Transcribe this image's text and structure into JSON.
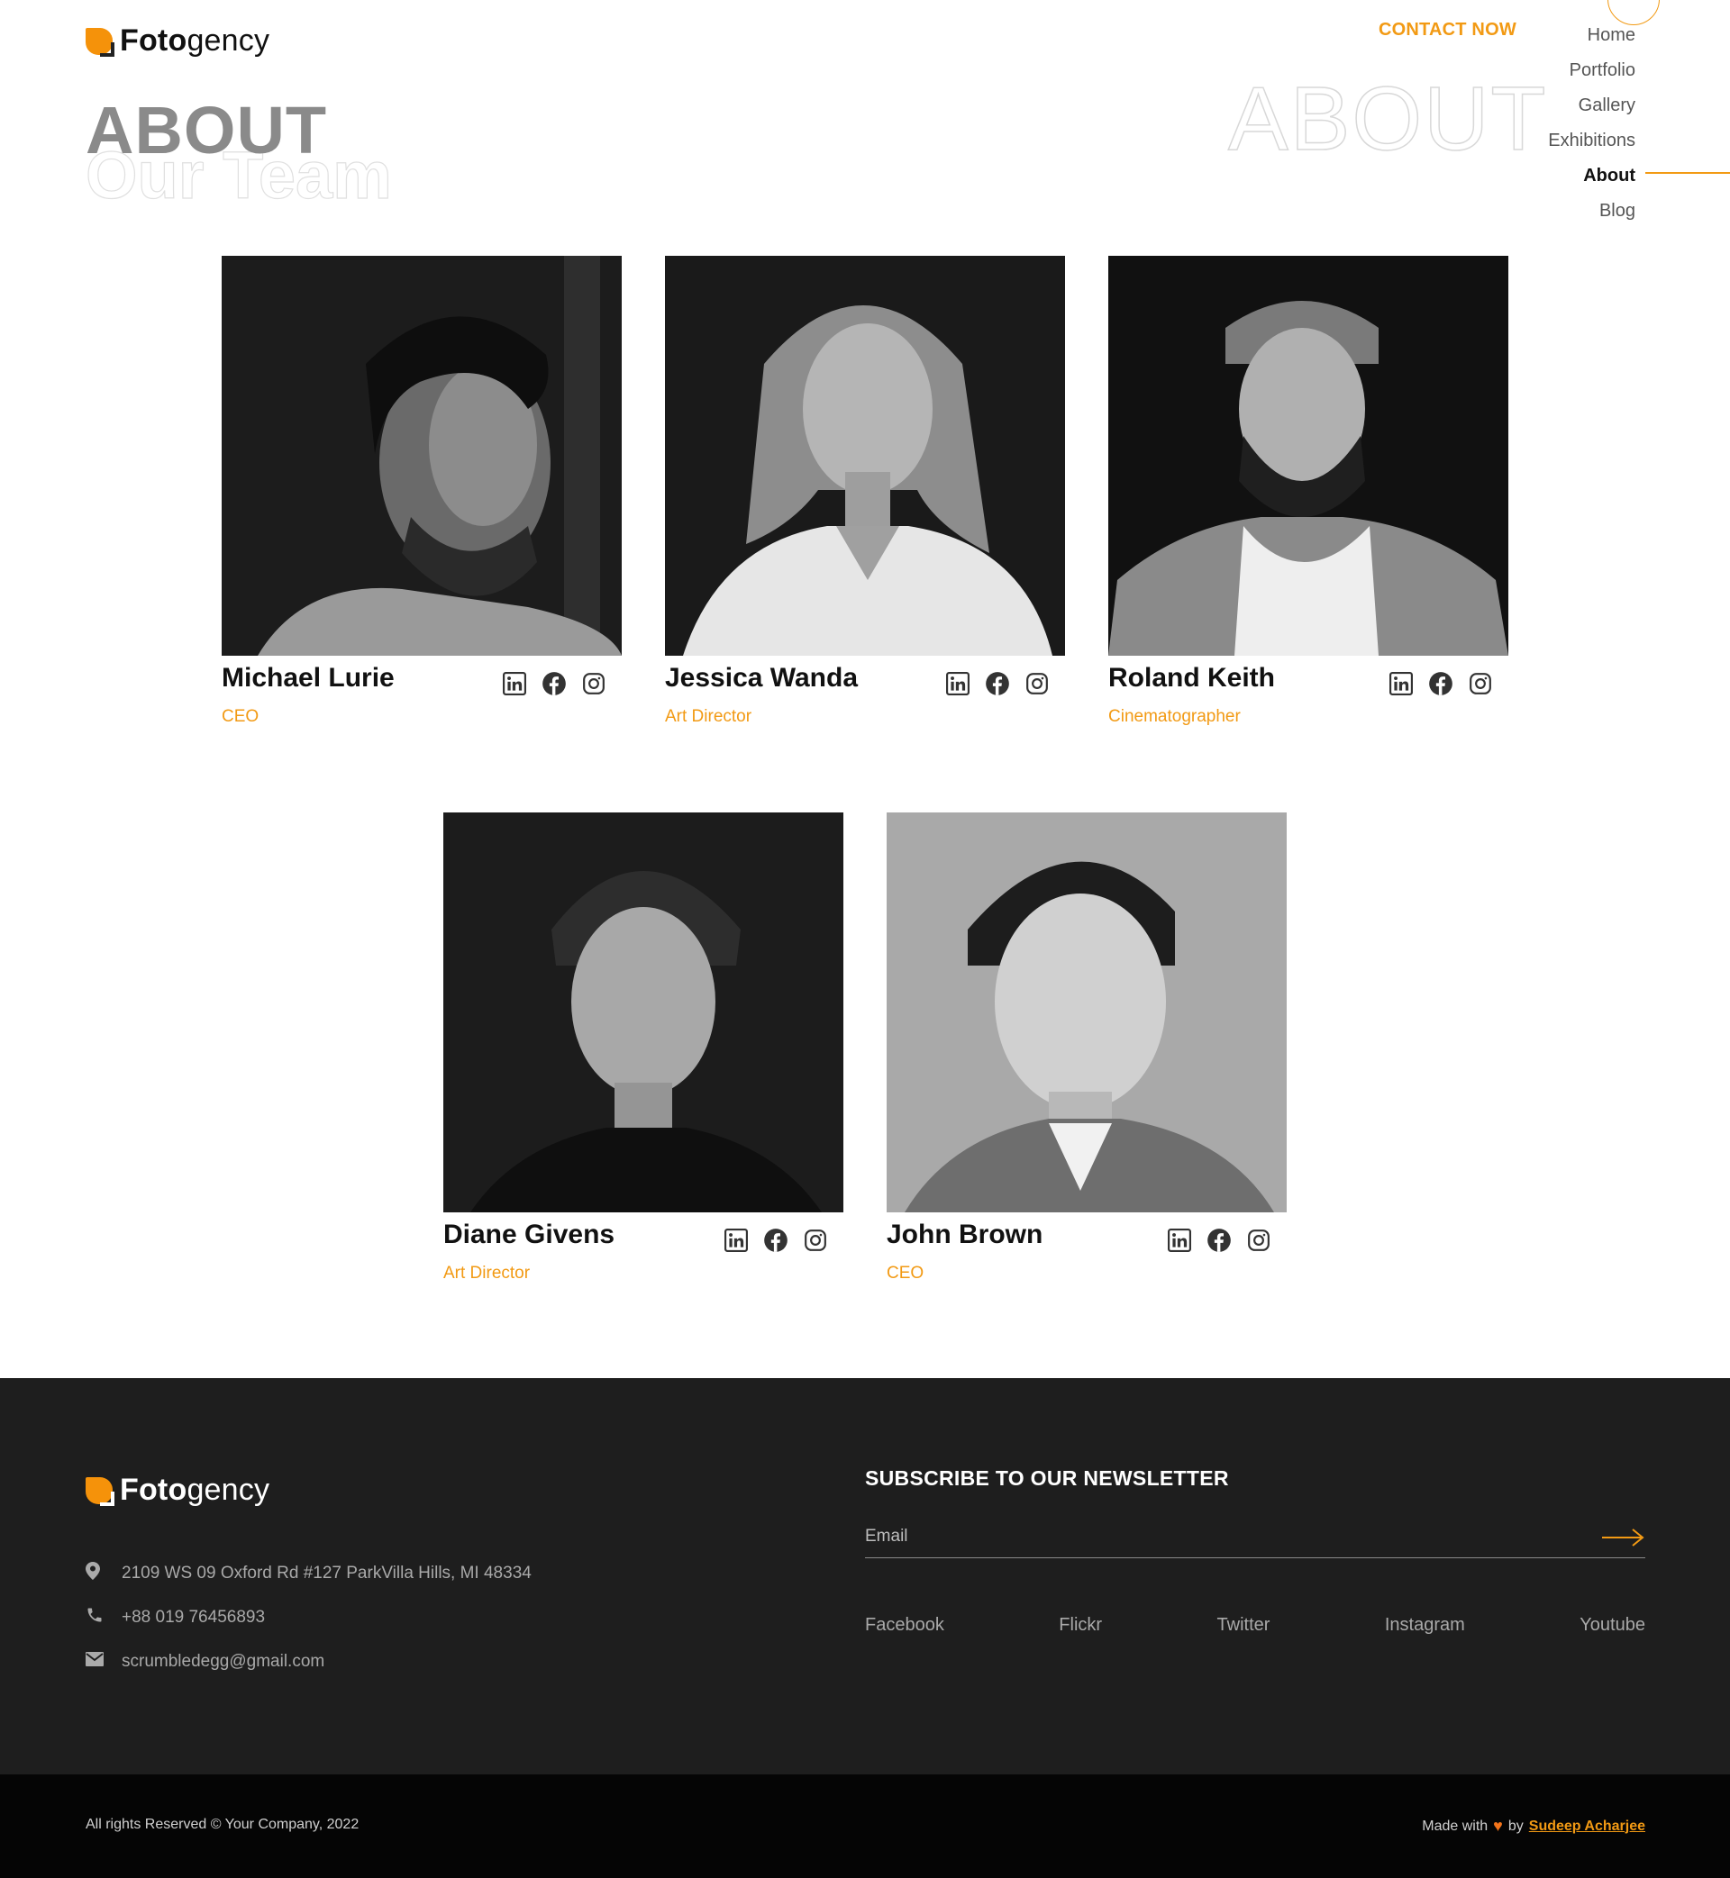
{
  "brand": {
    "bold": "Foto",
    "light": "gency"
  },
  "header": {
    "contact_label": "CONTACT NOW",
    "nav": [
      "Home",
      "Portfolio",
      "Gallery",
      "Exhibitions",
      "About",
      "Blog"
    ],
    "active_nav": "About"
  },
  "hero": {
    "title": "ABOUT",
    "subtitle_outline": "Our Team",
    "background_word": "ABOUT"
  },
  "team": [
    {
      "name": "Michael Lurie",
      "role": "CEO"
    },
    {
      "name": "Jessica Wanda",
      "role": "Art Director"
    },
    {
      "name": "Roland Keith",
      "role": "Cinematographer"
    },
    {
      "name": "Diane Givens",
      "role": "Art Director"
    },
    {
      "name": "John Brown",
      "role": "CEO"
    }
  ],
  "social_icons": [
    "linkedin-icon",
    "facebook-icon",
    "instagram-icon"
  ],
  "footer": {
    "address": "2109 WS 09 Oxford Rd #127 ParkVilla Hills, MI 48334",
    "phone": "+88 019 76456893",
    "email": "scrumbledegg@gmail.com",
    "newsletter_title": "SUBSCRIBE TO OUR NEWSLETTER",
    "email_placeholder": "Email",
    "social_links": [
      "Facebook",
      "Flickr",
      "Twitter",
      "Instagram",
      "Youtube"
    ]
  },
  "bottom": {
    "rights": "All rights Reserved © Your Company, 2022",
    "made_with": "Made with",
    "by": "by",
    "author": "Sudeep Acharjee"
  },
  "colors": {
    "accent": "#f29a14",
    "footer_bg": "#1e1e1e",
    "bottom_bg": "#050505"
  }
}
